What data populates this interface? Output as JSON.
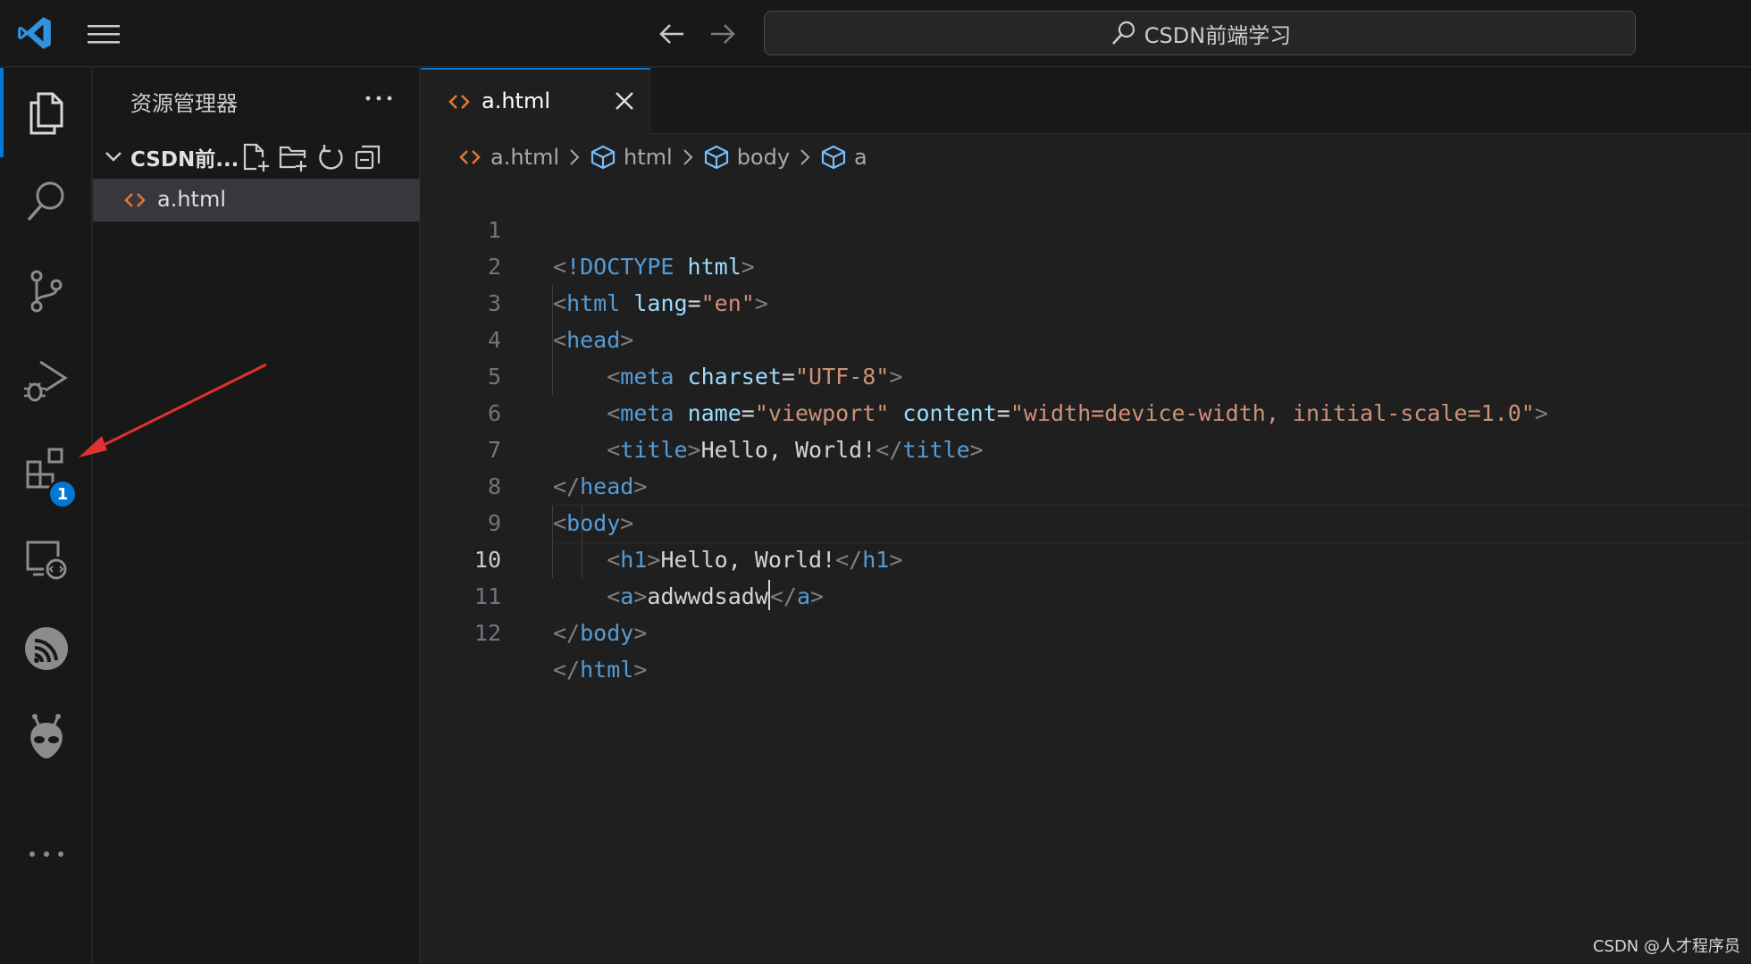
{
  "titlebar": {
    "search_text": "CSDN前端学习",
    "icons": [
      "vscode-logo-icon",
      "hamburger-menu-icon",
      "arrow-left-icon",
      "arrow-right-icon",
      "search-icon"
    ]
  },
  "activity_bar": {
    "items": [
      {
        "name": "explorer",
        "icon": "files-icon",
        "active": true
      },
      {
        "name": "search",
        "icon": "search-icon"
      },
      {
        "name": "source-control",
        "icon": "source-control-icon"
      },
      {
        "name": "run-and-debug",
        "icon": "debug-icon"
      },
      {
        "name": "extensions",
        "icon": "extensions-icon",
        "badge": "1"
      },
      {
        "name": "remote-explorer",
        "icon": "remote-explorer-icon"
      },
      {
        "name": "esp-idf",
        "icon": "esp-icon"
      },
      {
        "name": "platformio",
        "icon": "alien-icon"
      },
      {
        "name": "more",
        "icon": "ellipsis-icon"
      }
    ]
  },
  "sidebar": {
    "title": "资源管理器",
    "folder_name": "CSDN前...",
    "files": [
      {
        "name": "a.html",
        "icon": "html-file-icon"
      }
    ]
  },
  "editor": {
    "tab": {
      "label": "a.html"
    },
    "breadcrumb": [
      "a.html",
      "html",
      "body",
      "a"
    ],
    "current_line": 10,
    "lines": [
      {
        "n": "1"
      },
      {
        "n": "2"
      },
      {
        "n": "3"
      },
      {
        "n": "4"
      },
      {
        "n": "5"
      },
      {
        "n": "6"
      },
      {
        "n": "7"
      },
      {
        "n": "8"
      },
      {
        "n": "9"
      },
      {
        "n": "10"
      },
      {
        "n": "11"
      },
      {
        "n": "12"
      }
    ],
    "tokens": {
      "doctype": "!DOCTYPE",
      "html": "html",
      "lang_attr": "lang",
      "lang_val": "\"en\"",
      "head": "head",
      "meta": "meta",
      "charset_attr": "charset",
      "charset_val": "\"UTF-8\"",
      "name_attr": "name",
      "name_val": "\"viewport\"",
      "content_attr": "content",
      "content_val": "\"width=device-width, initial-scale=1.0\"",
      "title": "title",
      "title_text": "Hello, World!",
      "body": "body",
      "h1": "h1",
      "h1_text": "Hello, World!",
      "a": "a",
      "a_text": "adwwdsadw"
    }
  },
  "colors": {
    "accent": "#0078d4",
    "tag": "#569cd6",
    "attribute": "#9cdcfe",
    "string": "#ce9178",
    "annotation_arrow": "#e03131"
  },
  "watermark": "CSDN @人才程序员"
}
